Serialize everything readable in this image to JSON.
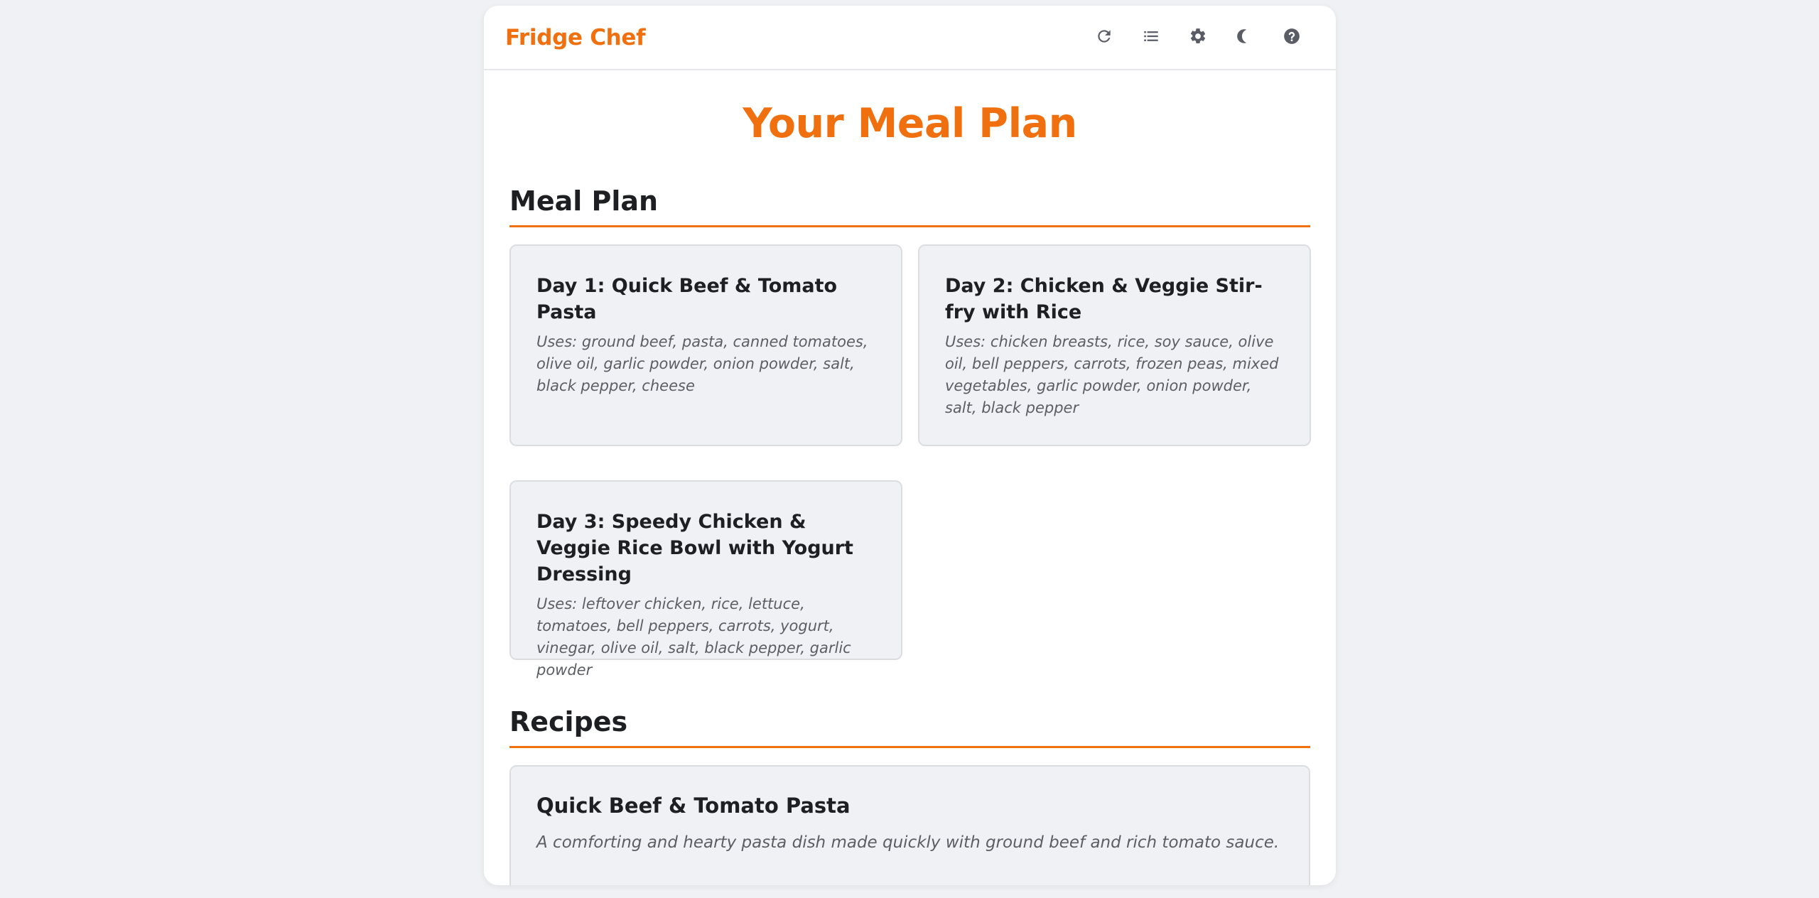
{
  "app": {
    "brand": "Fridge Chef"
  },
  "toolbar": [
    {
      "name": "refresh-icon",
      "title": "Refresh"
    },
    {
      "name": "list-icon",
      "title": "List"
    },
    {
      "name": "gear-icon",
      "title": "Settings"
    },
    {
      "name": "theme-icon",
      "title": "Theme"
    },
    {
      "name": "help-icon",
      "title": "Help"
    }
  ],
  "colors": {
    "accent": "#f0700f",
    "icon": "#5a5d66",
    "card_bg": "#f0f1f4",
    "page_bg": "#f0f1f4"
  },
  "page": {
    "title": "Your Meal Plan"
  },
  "meal_plan": {
    "heading": "Meal Plan",
    "days": [
      {
        "title": "Day 1: Quick Beef & Tomato Pasta",
        "uses": "Uses: ground beef, pasta, canned tomatoes, olive oil, garlic powder, onion powder, salt, black pepper, cheese"
      },
      {
        "title": "Day 2: Chicken & Veggie Stir-fry with Rice",
        "uses": "Uses: chicken breasts, rice, soy sauce, olive oil, bell peppers, carrots, frozen peas, mixed vegetables, garlic powder, onion powder, salt, black pepper"
      },
      {
        "title": "Day 3: Speedy Chicken & Veggie Rice Bowl with Yogurt Dressing",
        "uses": "Uses: leftover chicken, rice, lettuce, tomatoes, bell peppers, carrots, yogurt, vinegar, olive oil, salt, black pepper, garlic powder"
      }
    ]
  },
  "recipes": {
    "heading": "Recipes",
    "items": [
      {
        "title": "Quick Beef & Tomato Pasta",
        "description": "A comforting and hearty pasta dish made quickly with ground beef and rich tomato sauce."
      }
    ]
  }
}
